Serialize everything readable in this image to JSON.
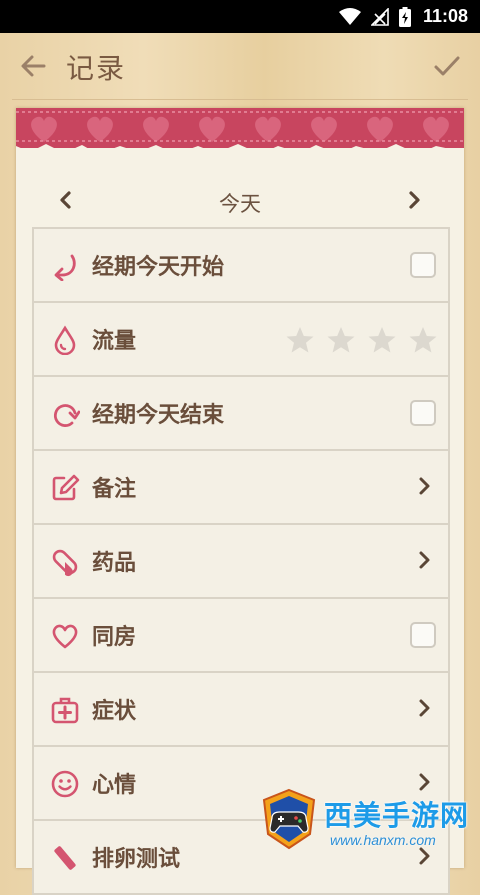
{
  "status_bar": {
    "time": "11:08",
    "icons": [
      "wifi-icon",
      "signal-icon",
      "battery-charging-icon"
    ]
  },
  "app_bar": {
    "title": "记录",
    "back_icon": "arrow-left-icon",
    "confirm_icon": "check-icon"
  },
  "date_nav": {
    "date_label": "今天"
  },
  "colors": {
    "accent": "#d45570",
    "text": "#6a4e3b",
    "star_empty": "#dcd8cf"
  },
  "rows": [
    {
      "label": "经期今天开始",
      "icon": "period-start-icon",
      "control": "checkbox",
      "checked": false
    },
    {
      "label": "流量",
      "icon": "drop-icon",
      "control": "stars",
      "rating": 0,
      "max": 4
    },
    {
      "label": "经期今天结束",
      "icon": "period-end-icon",
      "control": "checkbox",
      "checked": false
    },
    {
      "label": "备注",
      "icon": "edit-icon",
      "control": "chevron"
    },
    {
      "label": "药品",
      "icon": "pill-icon",
      "control": "chevron"
    },
    {
      "label": "同房",
      "icon": "heart-icon",
      "control": "checkbox",
      "checked": false
    },
    {
      "label": "症状",
      "icon": "medical-kit-icon",
      "control": "chevron"
    },
    {
      "label": "心情",
      "icon": "smile-icon",
      "control": "chevron"
    },
    {
      "label": "排卵测试",
      "icon": "test-strip-icon",
      "control": "chevron"
    }
  ],
  "watermark": {
    "text": "西美手游网",
    "url": "www.hanxm.com"
  }
}
